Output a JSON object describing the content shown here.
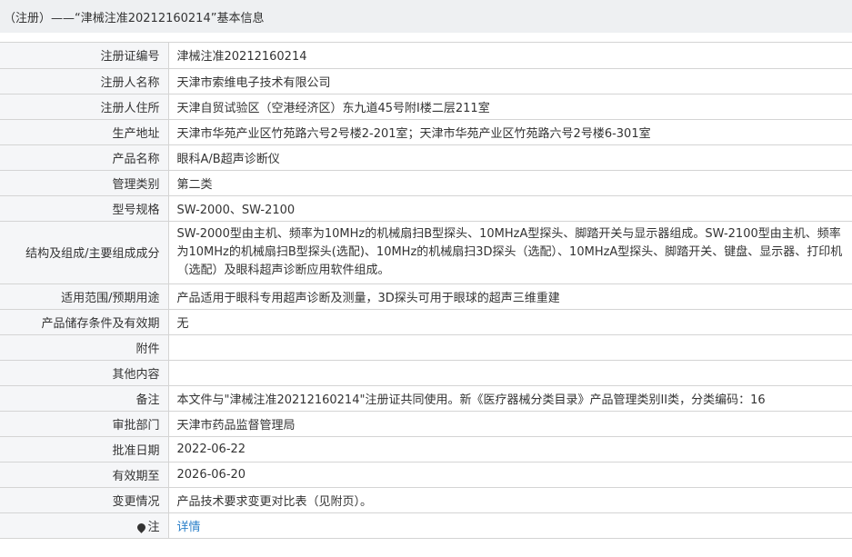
{
  "header": {
    "title": "（注册）——“津械注准20212160214”基本信息"
  },
  "rows": [
    {
      "label": "注册证编号",
      "value": "津械注准20212160214"
    },
    {
      "label": "注册人名称",
      "value": "天津市索维电子技术有限公司"
    },
    {
      "label": "注册人住所",
      "value": "天津自贸试验区（空港经济区）东九道45号附I楼二层211室"
    },
    {
      "label": "生产地址",
      "value": "天津市华苑产业区竹苑路六号2号楼2-201室；天津市华苑产业区竹苑路六号2号楼6-301室"
    },
    {
      "label": "产品名称",
      "value": "眼科A/B超声诊断仪"
    },
    {
      "label": "管理类别",
      "value": "第二类"
    },
    {
      "label": "型号规格",
      "value": "SW-2000、SW-2100"
    },
    {
      "label": "结构及组成/主要组成成分",
      "value": "SW-2000型由主机、频率为10MHz的机械扇扫B型探头、10MHzA型探头、脚踏开关与显示器组成。SW-2100型由主机、频率为10MHz的机械扇扫B型探头(选配)、10MHz的机械扇扫3D探头（选配）、10MHzA型探头、脚踏开关、键盘、显示器、打印机（选配）及眼科超声诊断应用软件组成。"
    },
    {
      "label": "适用范围/预期用途",
      "value": "产品适用于眼科专用超声诊断及测量，3D探头可用于眼球的超声三维重建"
    },
    {
      "label": "产品储存条件及有效期",
      "value": "无"
    },
    {
      "label": "附件",
      "value": ""
    },
    {
      "label": "其他内容",
      "value": ""
    },
    {
      "label": "备注",
      "value": "本文件与\"津械注准20212160214\"注册证共同使用。新《医疗器械分类目录》产品管理类别II类，分类编码：16"
    },
    {
      "label": "审批部门",
      "value": "天津市药品监督管理局"
    },
    {
      "label": "批准日期",
      "value": "2022-06-22"
    },
    {
      "label": "有效期至",
      "value": "2026-06-20"
    },
    {
      "label": "变更情况",
      "value": "产品技术要求变更对比表（见附页）。"
    }
  ],
  "note_row": {
    "label": "注",
    "icon": "location-pin-icon",
    "link_text": "详情",
    "link_color": "#2a7fc9"
  }
}
